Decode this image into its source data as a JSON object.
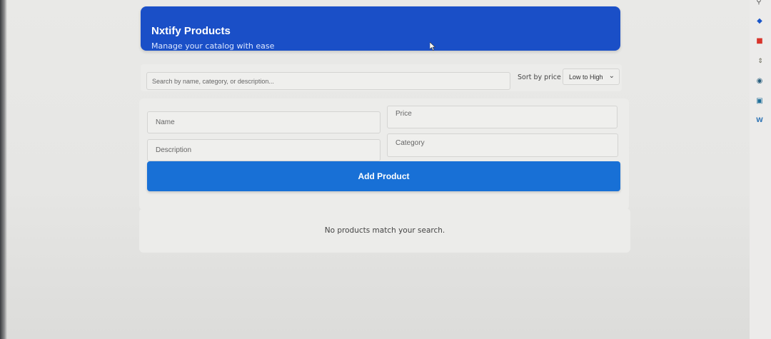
{
  "header": {
    "title": "Nxtify Products",
    "subtitle": "Manage your catalog with ease",
    "background": "#1a4fc7"
  },
  "search": {
    "placeholder": "Search by name, category, or description..."
  },
  "sort": {
    "label": "Sort by price",
    "selected": "Low to High"
  },
  "form": {
    "name_placeholder": "Name",
    "price_placeholder": "Price",
    "description_placeholder": "Description",
    "category_placeholder": "Category",
    "submit_label": "Add Product",
    "submit_color": "#1870d6"
  },
  "results": {
    "empty_message": "No products match your search."
  },
  "extensions": {
    "icons": [
      "search-icon",
      "diamond-icon",
      "bag-icon",
      "translate-icon",
      "record-icon",
      "mail-icon",
      "w-icon"
    ]
  }
}
